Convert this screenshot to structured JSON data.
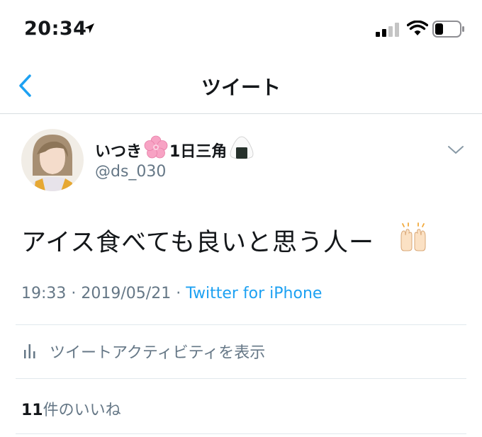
{
  "status_bar": {
    "time": "20:34"
  },
  "nav": {
    "title": "ツイート"
  },
  "tweet": {
    "display_name_prefix": "いつき",
    "display_name_suffix": "1日三角",
    "handle": "@ds_030",
    "text": "アイス食べても良いと思う人ー",
    "time": "19:33",
    "date": "2019/05/21",
    "separator": " · ",
    "source": "Twitter for iPhone"
  },
  "activity": {
    "label": "ツイートアクティビティを表示"
  },
  "likes": {
    "count": "11",
    "label": "件のいいね"
  },
  "icons": {
    "location": "location-arrow-icon",
    "signal": "cellular-signal-icon",
    "wifi": "wifi-icon",
    "battery": "battery-icon",
    "back": "chevron-left-icon",
    "more": "chevron-down-icon",
    "activity": "bar-chart-icon",
    "emoji_1": "cherry-blossom-emoji",
    "emoji_2": "rice-ball-emoji",
    "emoji_3": "raising-hands-emoji"
  },
  "colors": {
    "accent": "#1da1f2",
    "text": "#14171a",
    "secondary": "#657786",
    "divider": "#e1e8ed"
  }
}
